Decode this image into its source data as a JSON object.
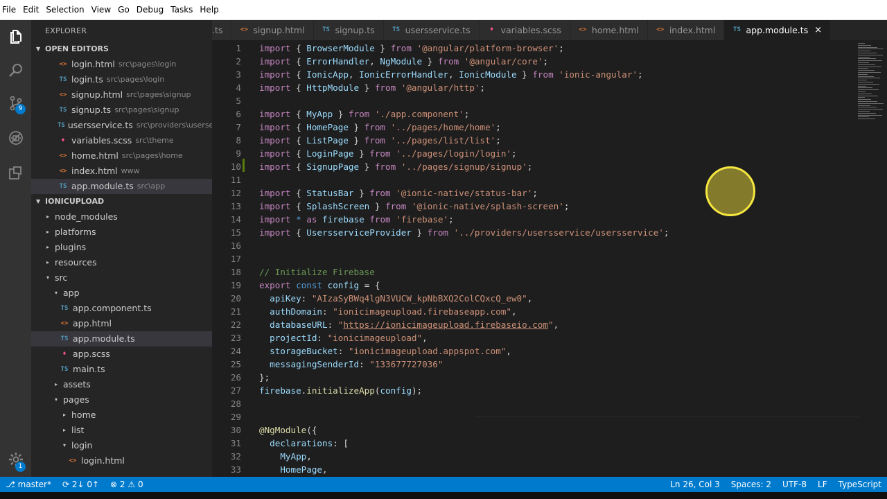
{
  "menu": [
    "File",
    "Edit",
    "Selection",
    "View",
    "Go",
    "Debug",
    "Tasks",
    "Help"
  ],
  "activity": {
    "scm_badge": "9",
    "settings_badge": "1"
  },
  "sidebar": {
    "title": "EXPLORER",
    "open_editors_label": "OPEN EDITORS",
    "open_editors": [
      {
        "icon": "<>",
        "type": "html",
        "name": "login.html",
        "path": "src\\pages\\login"
      },
      {
        "icon": "TS",
        "type": "ts",
        "name": "login.ts",
        "path": "src\\pages\\login"
      },
      {
        "icon": "<>",
        "type": "html",
        "name": "signup.html",
        "path": "src\\pages\\signup"
      },
      {
        "icon": "TS",
        "type": "ts",
        "name": "signup.ts",
        "path": "src\\pages\\signup"
      },
      {
        "icon": "TS",
        "type": "ts",
        "name": "usersservice.ts",
        "path": "src\\providers\\userse..."
      },
      {
        "icon": "♦",
        "type": "scss",
        "name": "variables.scss",
        "path": "src\\theme"
      },
      {
        "icon": "<>",
        "type": "html",
        "name": "home.html",
        "path": "src\\pages\\home"
      },
      {
        "icon": "<>",
        "type": "html",
        "name": "index.html",
        "path": "www"
      },
      {
        "icon": "TS",
        "type": "ts",
        "name": "app.module.ts",
        "path": "src\\app"
      }
    ],
    "project_label": "IONICUPLOAD",
    "tree": [
      {
        "indent": 0,
        "chev": "▸",
        "name": "node_modules"
      },
      {
        "indent": 0,
        "chev": "▸",
        "name": "platforms"
      },
      {
        "indent": 0,
        "chev": "▸",
        "name": "plugins"
      },
      {
        "indent": 0,
        "chev": "▸",
        "name": "resources"
      },
      {
        "indent": 0,
        "chev": "▾",
        "name": "src"
      },
      {
        "indent": 1,
        "chev": "▾",
        "name": "app"
      },
      {
        "indent": 2,
        "icon": "TS",
        "type": "ts",
        "name": "app.component.ts"
      },
      {
        "indent": 2,
        "icon": "<>",
        "type": "html",
        "name": "app.html"
      },
      {
        "indent": 2,
        "icon": "TS",
        "type": "ts",
        "name": "app.module.ts"
      },
      {
        "indent": 2,
        "icon": "♦",
        "type": "scss",
        "name": "app.scss"
      },
      {
        "indent": 2,
        "icon": "TS",
        "type": "ts",
        "name": "main.ts"
      },
      {
        "indent": 1,
        "chev": "▸",
        "name": "assets"
      },
      {
        "indent": 1,
        "chev": "▾",
        "name": "pages"
      },
      {
        "indent": 2,
        "chev": "▸",
        "name": "home"
      },
      {
        "indent": 2,
        "chev": "▸",
        "name": "list"
      },
      {
        "indent": 2,
        "chev": "▾",
        "name": "login"
      },
      {
        "indent": 3,
        "icon": "<>",
        "type": "html",
        "name": "login.html"
      }
    ]
  },
  "tabs": [
    {
      "icon": "",
      "type": "ts",
      "name": ".ts"
    },
    {
      "icon": "<>",
      "type": "html",
      "name": "signup.html"
    },
    {
      "icon": "TS",
      "type": "ts",
      "name": "signup.ts"
    },
    {
      "icon": "TS",
      "type": "ts",
      "name": "usersservice.ts"
    },
    {
      "icon": "♦",
      "type": "scss",
      "name": "variables.scss"
    },
    {
      "icon": "<>",
      "type": "html",
      "name": "home.html"
    },
    {
      "icon": "<>",
      "type": "html",
      "name": "index.html"
    },
    {
      "icon": "TS",
      "type": "ts",
      "name": "app.module.ts",
      "active": true,
      "close": "×"
    }
  ],
  "code": [
    [
      [
        "kw",
        "import"
      ],
      [
        "punc",
        " { "
      ],
      [
        "cls",
        "BrowserModule"
      ],
      [
        "punc",
        " } "
      ],
      [
        "kw",
        "from"
      ],
      [
        "punc",
        " "
      ],
      [
        "str",
        "'@angular/platform-browser'"
      ],
      [
        "punc",
        ";"
      ]
    ],
    [
      [
        "kw",
        "import"
      ],
      [
        "punc",
        " { "
      ],
      [
        "cls",
        "ErrorHandler"
      ],
      [
        "punc",
        ", "
      ],
      [
        "cls",
        "NgModule"
      ],
      [
        "punc",
        " } "
      ],
      [
        "kw",
        "from"
      ],
      [
        "punc",
        " "
      ],
      [
        "str",
        "'@angular/core'"
      ],
      [
        "punc",
        ";"
      ]
    ],
    [
      [
        "kw",
        "import"
      ],
      [
        "punc",
        " { "
      ],
      [
        "cls",
        "IonicApp"
      ],
      [
        "punc",
        ", "
      ],
      [
        "cls",
        "IonicErrorHandler"
      ],
      [
        "punc",
        ", "
      ],
      [
        "cls",
        "IonicModule"
      ],
      [
        "punc",
        " } "
      ],
      [
        "kw",
        "from"
      ],
      [
        "punc",
        " "
      ],
      [
        "str",
        "'ionic-angular'"
      ],
      [
        "punc",
        ";"
      ]
    ],
    [
      [
        "kw",
        "import"
      ],
      [
        "punc",
        " { "
      ],
      [
        "cls",
        "HttpModule"
      ],
      [
        "punc",
        " } "
      ],
      [
        "kw",
        "from"
      ],
      [
        "punc",
        " "
      ],
      [
        "str",
        "'@angular/http'"
      ],
      [
        "punc",
        ";"
      ]
    ],
    [],
    [
      [
        "kw",
        "import"
      ],
      [
        "punc",
        " { "
      ],
      [
        "cls",
        "MyApp"
      ],
      [
        "punc",
        " } "
      ],
      [
        "kw",
        "from"
      ],
      [
        "punc",
        " "
      ],
      [
        "str",
        "'./app.component'"
      ],
      [
        "punc",
        ";"
      ]
    ],
    [
      [
        "kw",
        "import"
      ],
      [
        "punc",
        " { "
      ],
      [
        "cls",
        "HomePage"
      ],
      [
        "punc",
        " } "
      ],
      [
        "kw",
        "from"
      ],
      [
        "punc",
        " "
      ],
      [
        "str",
        "'../pages/home/home'"
      ],
      [
        "punc",
        ";"
      ]
    ],
    [
      [
        "kw",
        "import"
      ],
      [
        "punc",
        " { "
      ],
      [
        "cls",
        "ListPage"
      ],
      [
        "punc",
        " } "
      ],
      [
        "kw",
        "from"
      ],
      [
        "punc",
        " "
      ],
      [
        "str",
        "'../pages/list/list'"
      ],
      [
        "punc",
        ";"
      ]
    ],
    [
      [
        "kw",
        "import"
      ],
      [
        "punc",
        " { "
      ],
      [
        "cls",
        "LoginPage"
      ],
      [
        "punc",
        " } "
      ],
      [
        "kw",
        "from"
      ],
      [
        "punc",
        " "
      ],
      [
        "str",
        "'../pages/login/login'"
      ],
      [
        "punc",
        ";"
      ]
    ],
    [
      [
        "kw",
        "import"
      ],
      [
        "punc",
        " { "
      ],
      [
        "cls",
        "SignupPage"
      ],
      [
        "punc",
        " } "
      ],
      [
        "kw",
        "from"
      ],
      [
        "punc",
        " "
      ],
      [
        "str",
        "'../pages/signup/signup'"
      ],
      [
        "punc",
        ";"
      ]
    ],
    [],
    [
      [
        "kw",
        "import"
      ],
      [
        "punc",
        " { "
      ],
      [
        "cls",
        "StatusBar"
      ],
      [
        "punc",
        " } "
      ],
      [
        "kw",
        "from"
      ],
      [
        "punc",
        " "
      ],
      [
        "str",
        "'@ionic-native/status-bar'"
      ],
      [
        "punc",
        ";"
      ]
    ],
    [
      [
        "kw",
        "import"
      ],
      [
        "punc",
        " { "
      ],
      [
        "cls",
        "SplashScreen"
      ],
      [
        "punc",
        " } "
      ],
      [
        "kw",
        "from"
      ],
      [
        "punc",
        " "
      ],
      [
        "str",
        "'@ionic-native/splash-screen'"
      ],
      [
        "punc",
        ";"
      ]
    ],
    [
      [
        "kw",
        "import"
      ],
      [
        "punc",
        " "
      ],
      [
        "kw2",
        "*"
      ],
      [
        "punc",
        " "
      ],
      [
        "kw",
        "as"
      ],
      [
        "punc",
        " "
      ],
      [
        "cls",
        "firebase"
      ],
      [
        "punc",
        " "
      ],
      [
        "kw",
        "from"
      ],
      [
        "punc",
        " "
      ],
      [
        "str",
        "'firebase'"
      ],
      [
        "punc",
        ";"
      ]
    ],
    [
      [
        "kw",
        "import"
      ],
      [
        "punc",
        " { "
      ],
      [
        "cls",
        "UsersserviceProvider"
      ],
      [
        "punc",
        " } "
      ],
      [
        "kw",
        "from"
      ],
      [
        "punc",
        " "
      ],
      [
        "str",
        "'../providers/usersservice/usersservice'"
      ],
      [
        "punc",
        ";"
      ]
    ],
    [],
    [],
    [
      [
        "cm",
        "// Initialize Firebase"
      ]
    ],
    [
      [
        "kw",
        "export"
      ],
      [
        "punc",
        " "
      ],
      [
        "kw2",
        "const"
      ],
      [
        "punc",
        " "
      ],
      [
        "cls",
        "config"
      ],
      [
        "punc",
        " = {"
      ]
    ],
    [
      [
        "punc",
        "  "
      ],
      [
        "cls",
        "apiKey"
      ],
      [
        "punc",
        ": "
      ],
      [
        "str",
        "\"AIzaSyBWq4lgN3VUCW_kpNbBXQ2ColCQxcQ_ew0\""
      ],
      [
        "punc",
        ","
      ]
    ],
    [
      [
        "punc",
        "  "
      ],
      [
        "cls",
        "authDomain"
      ],
      [
        "punc",
        ": "
      ],
      [
        "str",
        "\"ionicimageupload.firebaseapp.com\""
      ],
      [
        "punc",
        ","
      ]
    ],
    [
      [
        "punc",
        "  "
      ],
      [
        "cls",
        "databaseURL"
      ],
      [
        "punc",
        ": "
      ],
      [
        "str",
        "\""
      ],
      [
        "url",
        "https://ionicimageupload.firebaseio.com"
      ],
      [
        "str",
        "\""
      ],
      [
        "punc",
        ","
      ]
    ],
    [
      [
        "punc",
        "  "
      ],
      [
        "cls",
        "projectId"
      ],
      [
        "punc",
        ": "
      ],
      [
        "str",
        "\"ionicimageupload\""
      ],
      [
        "punc",
        ","
      ]
    ],
    [
      [
        "punc",
        "  "
      ],
      [
        "cls",
        "storageBucket"
      ],
      [
        "punc",
        ": "
      ],
      [
        "str",
        "\"ionicimageupload.appspot.com\""
      ],
      [
        "punc",
        ","
      ]
    ],
    [
      [
        "punc",
        "  "
      ],
      [
        "cls",
        "messagingSenderId"
      ],
      [
        "punc",
        ": "
      ],
      [
        "str",
        "\"133677727036\""
      ]
    ],
    [
      [
        "punc",
        "};"
      ]
    ],
    [
      [
        "cls",
        "firebase"
      ],
      [
        "punc",
        "."
      ],
      [
        "fn",
        "initializeApp"
      ],
      [
        "punc",
        "("
      ],
      [
        "cls",
        "config"
      ],
      [
        "punc",
        ");"
      ]
    ],
    [],
    [],
    [
      [
        "fn",
        "@NgModule"
      ],
      [
        "punc",
        "({"
      ]
    ],
    [
      [
        "punc",
        "  "
      ],
      [
        "cls",
        "declarations"
      ],
      [
        "punc",
        ": ["
      ]
    ],
    [
      [
        "punc",
        "    "
      ],
      [
        "cls",
        "MyApp"
      ],
      [
        "punc",
        ","
      ]
    ],
    [
      [
        "punc",
        "    "
      ],
      [
        "cls",
        "HomePage"
      ],
      [
        "punc",
        ","
      ]
    ]
  ],
  "status": {
    "branch": "master*",
    "sync": "⟳ 2↓ 0↑",
    "problems": "⊗ 2 ⚠ 0",
    "position": "Ln 26, Col 3",
    "spaces": "Spaces: 2",
    "encoding": "UTF-8",
    "eol": "LF",
    "language": "TypeScript"
  }
}
